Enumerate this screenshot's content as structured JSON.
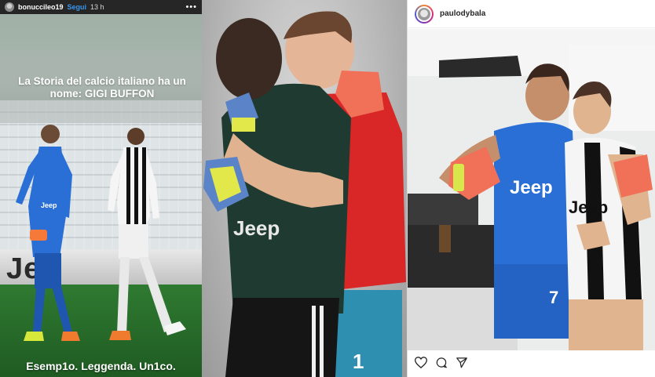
{
  "story": {
    "username": "bonuccileo19",
    "follow_label": "Segui",
    "time": "13 h",
    "more_label": "•••",
    "caption": "La Storia del calcio italiano ha un nome: GIGI BUFFON",
    "bottom_text": "Esemp1o. Leggenda. Un1co.",
    "ad_text": "Jee"
  },
  "hug_photo": {
    "jersey_text": "Jeep",
    "number": "1"
  },
  "post": {
    "username": "paulodybala",
    "jersey_text_left": "Jeep",
    "jersey_text_right": "Jeep",
    "number_left": "7",
    "actions": [
      "heart-icon",
      "comment-icon",
      "share-icon"
    ]
  },
  "colors": {
    "instagram_blue": "#3897f0",
    "juventus_blue_kit": "#2a6fd6",
    "goalkeeper_green": "#1f3b31",
    "goalkeeper_red": "#d92626"
  }
}
